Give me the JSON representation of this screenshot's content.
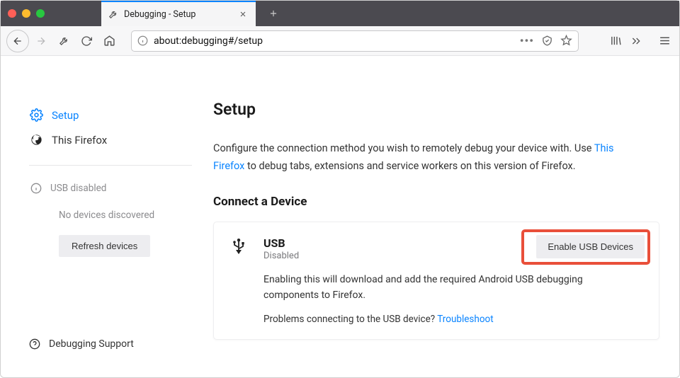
{
  "window": {
    "tab_title": "Debugging - Setup"
  },
  "urlbar": {
    "url": "about:debugging#/setup"
  },
  "sidebar": {
    "setup_label": "Setup",
    "this_firefox_label": "This Firefox",
    "usb_status": "USB disabled",
    "no_devices": "No devices discovered",
    "refresh_label": "Refresh devices",
    "support_label": "Debugging Support"
  },
  "main": {
    "title": "Setup",
    "desc_pre": "Configure the connection method you wish to remotely debug your device with. Use ",
    "desc_link": "This Firefox",
    "desc_post": " to debug tabs, extensions and service workers on this version of Firefox.",
    "connect_heading": "Connect a Device",
    "usb": {
      "title": "USB",
      "status": "Disabled",
      "enable_btn": "Enable USB Devices",
      "help_text": "Enabling this will download and add the required Android USB debugging components to Firefox.",
      "problems_pre": "Problems connecting to the USB device? ",
      "problems_link": "Troubleshoot"
    }
  }
}
